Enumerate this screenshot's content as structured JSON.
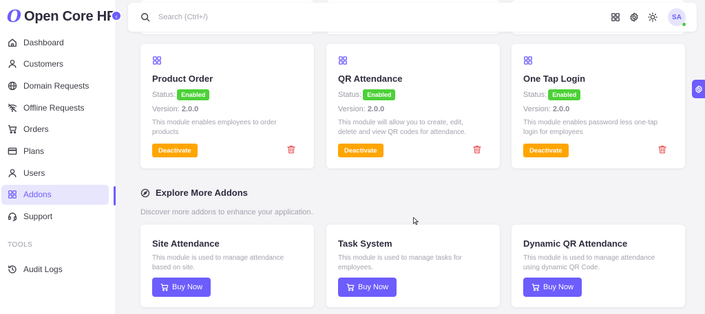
{
  "brand": {
    "name": "Open Core HR"
  },
  "sidebar": {
    "items": [
      {
        "label": "Dashboard",
        "icon": "home-icon"
      },
      {
        "label": "Customers",
        "icon": "user-icon"
      },
      {
        "label": "Domain Requests",
        "icon": "globe-icon"
      },
      {
        "label": "Offline Requests",
        "icon": "wifi-off-icon"
      },
      {
        "label": "Orders",
        "icon": "cart-icon"
      },
      {
        "label": "Plans",
        "icon": "credit-card-icon"
      },
      {
        "label": "Users",
        "icon": "user-icon"
      },
      {
        "label": "Addons",
        "icon": "grid-icon",
        "active": true
      },
      {
        "label": "Support",
        "icon": "headset-icon"
      }
    ],
    "section_label": "TOOLS",
    "tools_items": [
      {
        "label": "Audit Logs",
        "icon": "history-icon"
      }
    ]
  },
  "topbar": {
    "search_placeholder": "Search (Ctrl+/)",
    "avatar_initials": "SA"
  },
  "installed": [
    {
      "title": "Product Order",
      "status_label": "Status:",
      "status_value": "Enabled",
      "version_label": "Version:",
      "version_value": "2.0.0",
      "description": "This module enables employees to order products",
      "action_label": "Deactivate"
    },
    {
      "title": "QR Attendance",
      "status_label": "Status:",
      "status_value": "Enabled",
      "version_label": "Version:",
      "version_value": "2.0.0",
      "description": "This module will allow you to create, edit, delete and view QR codes for attendance.",
      "action_label": "Deactivate"
    },
    {
      "title": "One Tap Login",
      "status_label": "Status:",
      "status_value": "Enabled",
      "version_label": "Version:",
      "version_value": "2.0.0",
      "description": "This module enables password less one-tap login for employees",
      "action_label": "Deactivate"
    }
  ],
  "explore": {
    "title": "Explore More Addons",
    "subtitle": "Discover more addons to enhance your application.",
    "items": [
      {
        "title": "Site Attendance",
        "description": "This module is used to manage attendance based on site.",
        "action_label": "Buy Now"
      },
      {
        "title": "Task System",
        "description": "This module is used to manage tasks for employees.",
        "action_label": "Buy Now"
      },
      {
        "title": "Dynamic QR Attendance",
        "description": "This module is used to manage attendance using dynamic QR Code.",
        "action_label": "Buy Now"
      }
    ]
  },
  "colors": {
    "accent": "#6d5dfc",
    "enabled": "#4cd137",
    "deactivate": "#ffa500",
    "delete": "#ea5455"
  }
}
